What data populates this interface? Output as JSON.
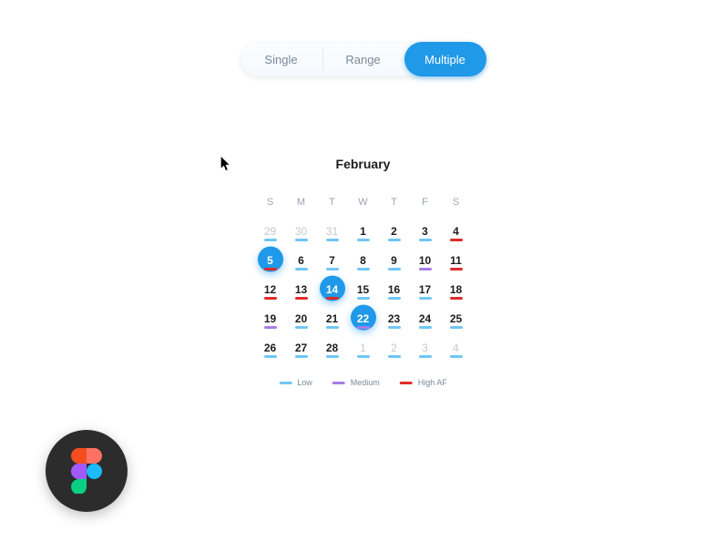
{
  "segmented": {
    "options": [
      {
        "label": "Single",
        "active": false
      },
      {
        "label": "Range",
        "active": false
      },
      {
        "label": "Multiple",
        "active": true
      }
    ]
  },
  "calendar": {
    "title": "February",
    "day_headers": [
      "S",
      "M",
      "T",
      "W",
      "T",
      "F",
      "S"
    ],
    "days": [
      {
        "n": 29,
        "other": true,
        "level": "low"
      },
      {
        "n": 30,
        "other": true,
        "level": "low"
      },
      {
        "n": 31,
        "other": true,
        "level": "low"
      },
      {
        "n": 1,
        "other": false,
        "level": "low"
      },
      {
        "n": 2,
        "other": false,
        "level": "low"
      },
      {
        "n": 3,
        "other": false,
        "level": "low"
      },
      {
        "n": 4,
        "other": false,
        "level": "high"
      },
      {
        "n": 5,
        "other": false,
        "level": "high",
        "selected": true
      },
      {
        "n": 6,
        "other": false,
        "level": "low"
      },
      {
        "n": 7,
        "other": false,
        "level": "low"
      },
      {
        "n": 8,
        "other": false,
        "level": "low"
      },
      {
        "n": 9,
        "other": false,
        "level": "low"
      },
      {
        "n": 10,
        "other": false,
        "level": "medium"
      },
      {
        "n": 11,
        "other": false,
        "level": "high"
      },
      {
        "n": 12,
        "other": false,
        "level": "high"
      },
      {
        "n": 13,
        "other": false,
        "level": "high"
      },
      {
        "n": 14,
        "other": false,
        "level": "high",
        "selected": true
      },
      {
        "n": 15,
        "other": false,
        "level": "low"
      },
      {
        "n": 16,
        "other": false,
        "level": "low"
      },
      {
        "n": 17,
        "other": false,
        "level": "low"
      },
      {
        "n": 18,
        "other": false,
        "level": "high"
      },
      {
        "n": 19,
        "other": false,
        "level": "medium"
      },
      {
        "n": 20,
        "other": false,
        "level": "low"
      },
      {
        "n": 21,
        "other": false,
        "level": "low"
      },
      {
        "n": 22,
        "other": false,
        "level": "medium",
        "selected": true
      },
      {
        "n": 23,
        "other": false,
        "level": "low"
      },
      {
        "n": 24,
        "other": false,
        "level": "low"
      },
      {
        "n": 25,
        "other": false,
        "level": "low"
      },
      {
        "n": 26,
        "other": false,
        "level": "low"
      },
      {
        "n": 27,
        "other": false,
        "level": "low"
      },
      {
        "n": 28,
        "other": false,
        "level": "low"
      },
      {
        "n": 1,
        "other": true,
        "level": "low"
      },
      {
        "n": 2,
        "other": true,
        "level": "low"
      },
      {
        "n": 3,
        "other": true,
        "level": "low"
      },
      {
        "n": 4,
        "other": true,
        "level": "low"
      }
    ]
  },
  "legend": {
    "items": [
      {
        "label": "Low",
        "level": "low"
      },
      {
        "label": "Medium",
        "level": "medium"
      },
      {
        "label": "High AF",
        "level": "high"
      }
    ]
  },
  "colors": {
    "accent": "#1f99e8",
    "low": "#6fc6f3",
    "medium": "#a77de8",
    "high": "#e02b2b"
  },
  "badge": {
    "name": "figma"
  }
}
